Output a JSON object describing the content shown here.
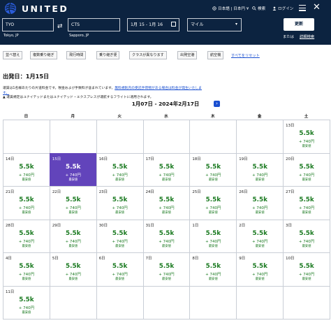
{
  "header": {
    "brand": "UNITED",
    "language": "日本語 | 日本円 ¥",
    "search": "検索",
    "login": "ログイン"
  },
  "search": {
    "origin_code": "TYO",
    "origin_name": "Tokyo, JP",
    "destination_code": "CTS",
    "destination_name": "Sapporo, JP",
    "dates": "1月 15 - 1月 16",
    "fare_type": "マイル",
    "update_label": "更新",
    "or_label": "または",
    "advanced_label": "詳細検索"
  },
  "filters": [
    "並べ替え",
    "複数乗り継ぎ",
    "飛行時間",
    "乗り継ぎ便",
    "クラスが異なります",
    "出発空港",
    "航空機"
  ],
  "reset_label": "すべてをリセット",
  "departure_title": "出発日：1月15日",
  "notes": {
    "line1_prefix": "運賃は1名様あたりの片道料金です。税金および手数料が含まれています。",
    "line1_link": "無料規則内の受託手荷物がある場合は料金が発生いたしま",
    "line2_link": "す。",
    "line3": "運賃規定はユナイテッドまたはユナイテッド・エクスプレスが運航するフライトに適用されます。"
  },
  "calendar": {
    "range": "1月07日 - 2024年2月17日",
    "weekdays": [
      "日",
      "月",
      "火",
      "水",
      "木",
      "金",
      "土"
    ],
    "selected_day": "15日",
    "weeks": [
      [
        null,
        null,
        null,
        null,
        null,
        null,
        {
          "day": "13日",
          "price": "5.5k",
          "tax": "+ 740円",
          "tag": "最安値"
        }
      ],
      [
        {
          "day": "14日",
          "price": "5.5k",
          "tax": "+ 740円",
          "tag": "最安値"
        },
        {
          "day": "15日",
          "price": "5.5k",
          "tax": "+ 740円",
          "tag": "最安値"
        },
        {
          "day": "16日",
          "price": "5.5k",
          "tax": "+ 740円",
          "tag": "最安値"
        },
        {
          "day": "17日",
          "price": "5.5k",
          "tax": "+ 740円",
          "tag": "最安値"
        },
        {
          "day": "18日",
          "price": "5.5k",
          "tax": "+ 740円",
          "tag": "最安値"
        },
        {
          "day": "19日",
          "price": "5.5k",
          "tax": "+ 740円",
          "tag": "最安値"
        },
        {
          "day": "20日",
          "price": "5.5k",
          "tax": "+ 740円",
          "tag": "最安値"
        }
      ],
      [
        {
          "day": "21日",
          "price": "5.5k",
          "tax": "+ 740円",
          "tag": "最安値"
        },
        {
          "day": "22日",
          "price": "5.5k",
          "tax": "+ 740円",
          "tag": "最安値"
        },
        {
          "day": "23日",
          "price": "5.5k",
          "tax": "+ 740円",
          "tag": "最安値"
        },
        {
          "day": "24日",
          "price": "5.5k",
          "tax": "+ 740円",
          "tag": "最安値"
        },
        {
          "day": "25日",
          "price": "5.5k",
          "tax": "+ 740円",
          "tag": "最安値"
        },
        {
          "day": "26日",
          "price": "5.5k",
          "tax": "+ 740円",
          "tag": "最安値"
        },
        {
          "day": "27日",
          "price": "5.5k",
          "tax": "+ 740円",
          "tag": "最安値"
        }
      ],
      [
        {
          "day": "28日",
          "price": "5.5k",
          "tax": "+ 740円",
          "tag": "最安値"
        },
        {
          "day": "29日",
          "price": "5.5k",
          "tax": "+ 740円",
          "tag": "最安値"
        },
        {
          "day": "30日",
          "price": "5.5k",
          "tax": "+ 740円",
          "tag": "最安値"
        },
        {
          "day": "31日",
          "price": "5.5k",
          "tax": "+ 740円",
          "tag": "最安値"
        },
        {
          "day": "1日",
          "price": "5.5k",
          "tax": "+ 740円",
          "tag": "最安値"
        },
        {
          "day": "2日",
          "price": "5.5k",
          "tax": "+ 740円",
          "tag": "最安値"
        },
        {
          "day": "3日",
          "price": "5.5k",
          "tax": "+ 740円",
          "tag": "最安値"
        }
      ],
      [
        {
          "day": "4日",
          "price": "5.5k",
          "tax": "+ 740円",
          "tag": "最安値"
        },
        {
          "day": "5日",
          "price": "5.5k",
          "tax": "+ 740円",
          "tag": "最安値"
        },
        {
          "day": "6日",
          "price": "5.5k",
          "tax": "+ 740円",
          "tag": "最安値"
        },
        {
          "day": "7日",
          "price": "5.5k",
          "tax": "+ 740円",
          "tag": "最安値"
        },
        {
          "day": "8日",
          "price": "5.5k",
          "tax": "+ 740円",
          "tag": "最安値"
        },
        {
          "day": "9日",
          "price": "5.5k",
          "tax": "+ 740円",
          "tag": "最安値"
        },
        {
          "day": "10日",
          "price": "5.5k",
          "tax": "+ 740円",
          "tag": "最安値"
        }
      ],
      [
        {
          "day": "11日",
          "price": "5.5k",
          "tax": "+ 740円",
          "tag": "最安値"
        },
        null,
        null,
        null,
        null,
        null,
        null
      ]
    ]
  },
  "colors": {
    "navy": "#0c2340",
    "selected": "#6244bb",
    "price_green": "#1a7a20",
    "link_blue": "#1a4fd0"
  }
}
